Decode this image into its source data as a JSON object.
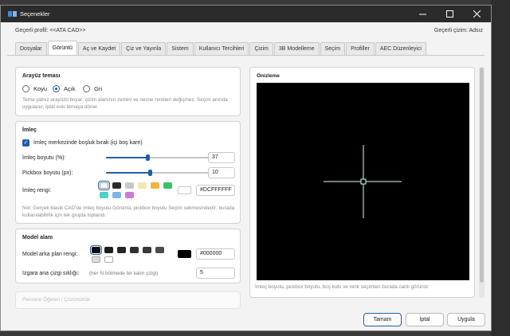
{
  "window": {
    "title": "Seçenekler"
  },
  "header": {
    "profile_label": "Geçerli profil:",
    "profile_value": "<<ATA CAD>>",
    "drawing_label": "Geçerli çizim:",
    "drawing_value": "Adsız"
  },
  "tabs": [
    {
      "label": "Dosyalar"
    },
    {
      "label": "Görüntü",
      "active": true
    },
    {
      "label": "Aç ve Kaydet"
    },
    {
      "label": "Çiz ve Yayınla"
    },
    {
      "label": "Sistem"
    },
    {
      "label": "Kullanıcı Tercihleri"
    },
    {
      "label": "Çizim"
    },
    {
      "label": "3B Modelleme"
    },
    {
      "label": "Seçim"
    },
    {
      "label": "Profiller"
    },
    {
      "label": "AEC Düzenleyici"
    }
  ],
  "theme": {
    "title": "Arayüz teması",
    "options": [
      "Koyu",
      "Açık",
      "Gri"
    ],
    "selected": "Açık",
    "note": "Tema yalnız arayüzü boyar; çizim alanının zemini ve nesne renkleri değişmez. Seçim anında uygulanır, İptal eski temaya döner."
  },
  "cursor": {
    "title": "İmleç",
    "center_box_label": "İmleç merkezinde boşluk bırak (içi boş kare)",
    "size_label": "İmleç boyutu (%):",
    "size_value": "37",
    "size_fraction": 0.37,
    "pickbox_label": "Pickbox boyutu (px):",
    "pickbox_value": "10",
    "pickbox_fraction": 0.39,
    "color_label": "İmleç rengi:",
    "color_value": "#DCFFFFFF",
    "swatches": [
      "#ffffff",
      "#2b2b2b",
      "#c8c8c8",
      "#f4e6b0",
      "#f2b43c",
      "#3dbf68",
      "#4ed3c8",
      "#7fb3ea",
      "#cf79d8"
    ],
    "note": "Not: Gerçek klasik CAD'de imleç boyutu Görüntü, pickbox boyutu Seçim sekmesindedir; burada kullanılabilirlik için tek grupta toplandı."
  },
  "model": {
    "title": "Model alanı",
    "bg_label": "Model arka plan rengi:",
    "bg_value": "#000000",
    "swatches": [
      "#0b0b0b",
      "#1e1e1e",
      "#262626",
      "#2f2f2f",
      "#383838",
      "#4a4a4a",
      "#dcdcdc",
      "#ffffff"
    ],
    "grid_label": "Izgara ana çizgi sıklığı:",
    "grid_hint": "(her N bölmede bir kalın çizgi)",
    "grid_value": "5"
  },
  "next_group": {
    "title": "Pencere Öğeleri / Çözünürlük"
  },
  "preview": {
    "title": "Önizleme",
    "note": "İmleç boyutu, pickbox boyutu, boş kutu ve renk seçimleri burada canlı görünür."
  },
  "buttons": {
    "ok": "Tamam",
    "cancel": "İptal",
    "apply": "Uygula"
  }
}
